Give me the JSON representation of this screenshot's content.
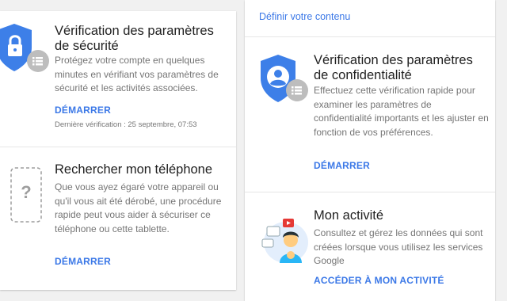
{
  "left": {
    "security": {
      "title": "Vérification des paramètres de sécurité",
      "description": "Protégez votre compte en quelques minutes en vérifiant vos paramètres de sécurité et les activités associées.",
      "action": "DÉMARRER",
      "last_check": "Dernière vérification : 25 septembre, 07:53",
      "icon": "shield-lock-icon"
    },
    "phone": {
      "title": "Rechercher mon téléphone",
      "description": "Que vous ayez égaré votre appareil ou qu'il vous ait été dérobé, une procédure rapide peut vous aider à sécuriser ce téléphone ou cette tablette.",
      "action": "DÉMARRER",
      "icon": "phone-question-icon"
    }
  },
  "right": {
    "top_link": "Définir votre contenu",
    "privacy": {
      "title": "Vérification des paramètres de confidentialité",
      "description": "Effectuez cette vérification rapide pour examiner les paramètres de confidentialité importants et les ajuster en fonction de vos préférences.",
      "action": "DÉMARRER",
      "icon": "shield-person-icon"
    },
    "activity": {
      "title": "Mon activité",
      "description": "Consultez et gérez les données qui sont créées lorsque vous utilisez les services Google",
      "action": "ACCÉDER À MON ACTIVITÉ",
      "icon": "activity-illustration-icon"
    }
  },
  "colors": {
    "accent": "#3b78e7",
    "shield_blue": "#3d7fe8",
    "badge_gray": "#bdbdbd"
  }
}
